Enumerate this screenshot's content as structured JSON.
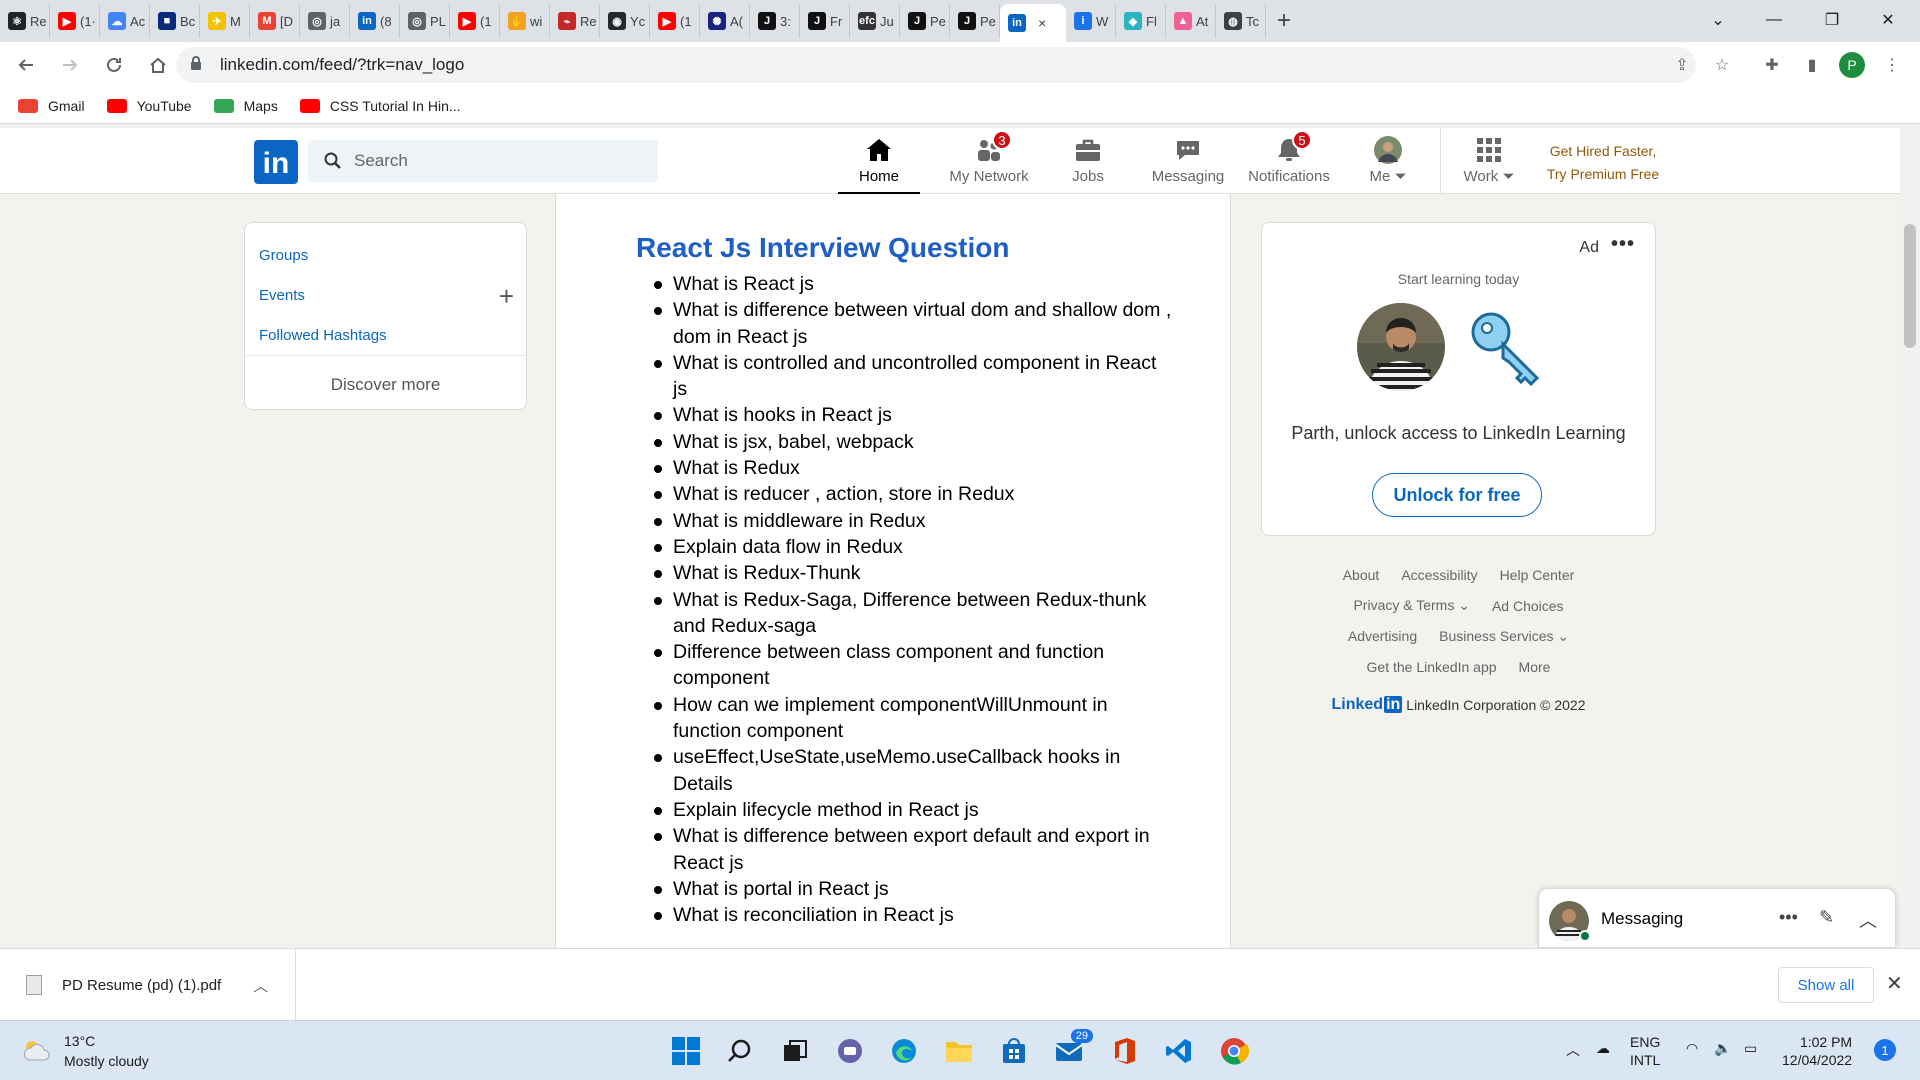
{
  "browser": {
    "tabs": [
      {
        "label": "Re",
        "color": "#20232a",
        "glyph": "⚛"
      },
      {
        "label": "(1·",
        "color": "#ff0000",
        "glyph": "▶"
      },
      {
        "label": "Ac",
        "color": "#4285f4",
        "glyph": "☁"
      },
      {
        "label": "Bc",
        "color": "#0a2a7a",
        "glyph": "■"
      },
      {
        "label": "M",
        "color": "#f2c200",
        "glyph": "✈"
      },
      {
        "label": "[D",
        "color": "#ea4335",
        "glyph": "M"
      },
      {
        "label": "ja",
        "color": "#5f6368",
        "glyph": "◎"
      },
      {
        "label": "(8",
        "color": "#0a66c2",
        "glyph": "in"
      },
      {
        "label": "PL",
        "color": "#5f6368",
        "glyph": "◎"
      },
      {
        "label": "(1",
        "color": "#ff0000",
        "glyph": "▶"
      },
      {
        "label": "wi",
        "color": "#f4a21d",
        "glyph": "✋"
      },
      {
        "label": "Re",
        "color": "#c62828",
        "glyph": "⌁"
      },
      {
        "label": "Yc",
        "color": "#24292f",
        "glyph": "◉"
      },
      {
        "label": "(1",
        "color": "#ff0000",
        "glyph": "▶"
      },
      {
        "label": "A(",
        "color": "#1a237e",
        "glyph": "✺"
      },
      {
        "label": "3:",
        "color": "#111111",
        "glyph": "J"
      },
      {
        "label": "Fr",
        "color": "#111111",
        "glyph": "J"
      },
      {
        "label": "Ju",
        "color": "#333333",
        "glyph": "efc"
      },
      {
        "label": "Pe",
        "color": "#111111",
        "glyph": "J"
      },
      {
        "label": "Pe",
        "color": "#111111",
        "glyph": "J"
      },
      {
        "label": "",
        "color": "#0a66c2",
        "glyph": "in",
        "active": true
      },
      {
        "label": "W",
        "color": "#1a73e8",
        "glyph": "i"
      },
      {
        "label": "Fl",
        "color": "#2bb3c0",
        "glyph": "◆"
      },
      {
        "label": "At",
        "color": "#f06292",
        "glyph": "▲"
      },
      {
        "label": "Tc",
        "color": "#3c4043",
        "glyph": "◍"
      }
    ],
    "active_tab_close": "×",
    "new_tab": "+",
    "url": "linkedin.com/feed/?trk=nav_logo",
    "profile_initial": "P",
    "bookmarks": [
      {
        "label": "Gmail",
        "color": "#ea4335"
      },
      {
        "label": "YouTube",
        "color": "#ff0000"
      },
      {
        "label": "Maps",
        "color": "#34a853"
      },
      {
        "label": "CSS Tutorial In Hin...",
        "color": "#ff0000"
      }
    ]
  },
  "linkedin": {
    "logo": "in",
    "search_placeholder": "Search",
    "nav": {
      "home": "Home",
      "network": "My Network",
      "network_badge": "3",
      "jobs": "Jobs",
      "messaging": "Messaging",
      "notifications": "Notifications",
      "notifications_badge": "5",
      "me": "Me",
      "work": "Work"
    },
    "premium_line1": "Get Hired Faster,",
    "premium_line2": "Try Premium Free",
    "left": {
      "groups": "Groups",
      "events": "Events",
      "hashtags": "Followed Hashtags",
      "discover": "Discover more"
    },
    "post": {
      "title": "React Js Interview Question",
      "questions": [
        "What is React js",
        "What is difference between  virtual dom and shallow dom , dom in React js",
        "What is controlled and uncontrolled component in React js",
        "What is hooks in React js",
        "What is jsx, babel, webpack",
        "What is Redux",
        "What is reducer , action, store in Redux",
        "What is middleware in Redux",
        " Explain data flow in Redux",
        "What is  Redux-Thunk",
        "What is  Redux-Saga, Difference between Redux-thunk and Redux-saga",
        "Difference between class component and function component",
        "How can we implement componentWillUnmount in function component",
        "useEffect,UseState,useMemo.useCallback hooks  in Details",
        "Explain lifecycle method  in React js",
        "What is difference between export default and export in React js",
        "What is portal  in React js",
        "What is reconciliation  in React js"
      ]
    },
    "ad": {
      "label": "Ad",
      "more": "•••",
      "subtitle": "Start learning today",
      "message": "Parth, unlock access to LinkedIn Learning",
      "button": "Unlock for free"
    },
    "footer": {
      "about": "About",
      "accessibility": "Accessibility",
      "help": "Help Center",
      "privacy": "Privacy & Terms",
      "adchoices": "Ad Choices",
      "advertising": "Advertising",
      "business": "Business Services",
      "app": "Get the LinkedIn app",
      "more": "More",
      "brand_word": "Linked",
      "brand_in": "in",
      "corporation": "LinkedIn Corporation © 2022"
    },
    "messaging_dock": {
      "label": "Messaging"
    }
  },
  "downloads": {
    "file": "PD Resume (pd) (1).pdf",
    "show_all": "Show all"
  },
  "taskbar": {
    "temp": "13°C",
    "condition": "Mostly cloudy",
    "mail_badge": "29",
    "lang1": "ENG",
    "lang2": "INTL",
    "time": "1:02 PM",
    "date": "12/04/2022",
    "notifications": "1"
  }
}
